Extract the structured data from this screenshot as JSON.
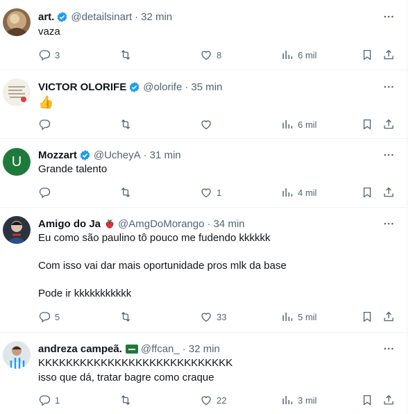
{
  "posts": [
    {
      "name": "art.",
      "handle": "@detailsinart",
      "separator": "·",
      "time": "32 min",
      "lines": [
        "vaza"
      ],
      "replies": "3",
      "reposts": "",
      "likes": "8",
      "views": "6 mil",
      "verified": true
    },
    {
      "name": "VICTOR OLORIFE",
      "handle": "@olorife",
      "separator": "·",
      "time": "35 min",
      "lines": [
        "👍"
      ],
      "replies": "",
      "reposts": "",
      "likes": "",
      "views": "6 mil",
      "verified": true
    },
    {
      "name": "Mozzart",
      "handle": "@UcheyA",
      "separator": "·",
      "time": "31 min",
      "lines": [
        "Grande talento"
      ],
      "replies": "",
      "reposts": "",
      "likes": "1",
      "views": "4 mil",
      "verified": true,
      "avatar_letter": "U"
    },
    {
      "name": "Amigo do Ja",
      "handle": "@AmgDoMorango",
      "separator": "·",
      "time": "34 min",
      "lines": [
        "Eu como são paulino tô pouco me fudendo kkkkkk",
        "Com isso vai dar mais oportunidade pros mlk da base",
        "Pode ir kkkkkkkkkkk"
      ],
      "replies": "5",
      "reposts": "",
      "likes": "33",
      "views": "5 mil",
      "verified": false
    },
    {
      "name": "andreza campeã.",
      "handle": "@ffcan_",
      "separator": "·",
      "time": "32 min",
      "lines": [
        "KKKKKKKKKKKKKKKKKKKKKKKKKKKK",
        "isso que dá, tratar bagre como craque"
      ],
      "replies": "1",
      "reposts": "",
      "likes": "22",
      "views": "3 mil",
      "verified": false
    }
  ],
  "colors": {
    "text": "#0f1419",
    "muted": "#536471",
    "verified": "#1d9bf0",
    "avatar_mozzart": "#1e7a3a",
    "divider": "#eff3f4"
  },
  "icons": {
    "reply": "reply-icon",
    "repost": "repost-icon",
    "like": "like-icon",
    "views": "views-icon",
    "bookmark": "bookmark-icon",
    "share": "share-icon",
    "more": "more-icon"
  }
}
